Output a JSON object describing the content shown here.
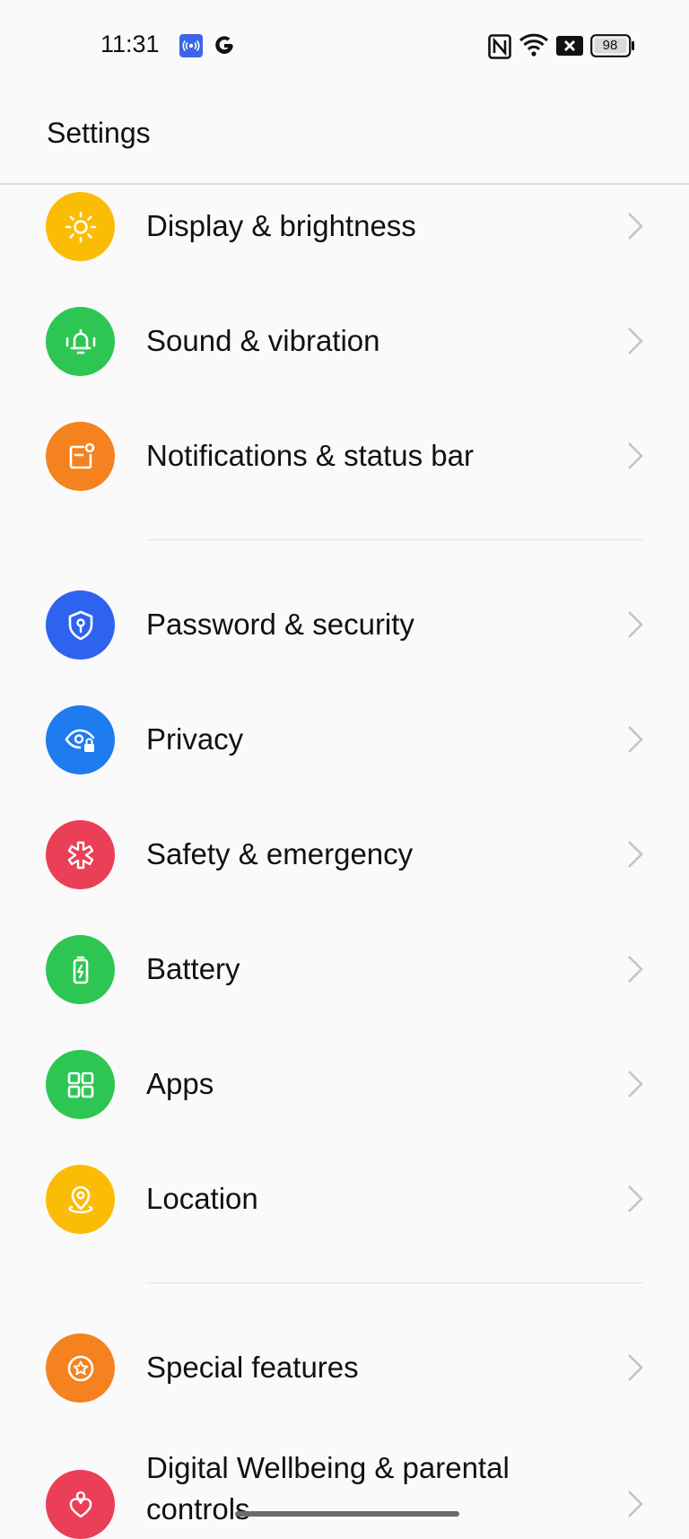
{
  "status_bar": {
    "time": "11:31",
    "battery_level": "98",
    "icons": [
      "nfc-app-icon",
      "google-icon",
      "nfc-icon",
      "wifi-icon",
      "data-off-icon",
      "battery-icon"
    ]
  },
  "header": {
    "title": "Settings"
  },
  "items": [
    {
      "label": "Display & brightness",
      "icon": "sun-icon",
      "color": "#FBBC05"
    },
    {
      "label": "Sound & vibration",
      "icon": "bell-icon",
      "color": "#2DC653"
    },
    {
      "label": "Notifications & status bar",
      "icon": "notification-icon",
      "color": "#F5821F"
    },
    {
      "label": "Password & security",
      "icon": "shield-key-icon",
      "color": "#2E63F0"
    },
    {
      "label": "Privacy",
      "icon": "eye-lock-icon",
      "color": "#1E7BF0"
    },
    {
      "label": "Safety & emergency",
      "icon": "asterisk-icon",
      "color": "#EA3F56"
    },
    {
      "label": "Battery",
      "icon": "battery-charge-icon",
      "color": "#2DC653"
    },
    {
      "label": "Apps",
      "icon": "apps-grid-icon",
      "color": "#2DC653"
    },
    {
      "label": "Location",
      "icon": "location-pin-icon",
      "color": "#FBBC05"
    },
    {
      "label": "Special features",
      "icon": "star-circle-icon",
      "color": "#F5821F"
    },
    {
      "label": "Digital Wellbeing & parental controls",
      "icon": "heart-person-icon",
      "color": "#EA3F56"
    }
  ]
}
